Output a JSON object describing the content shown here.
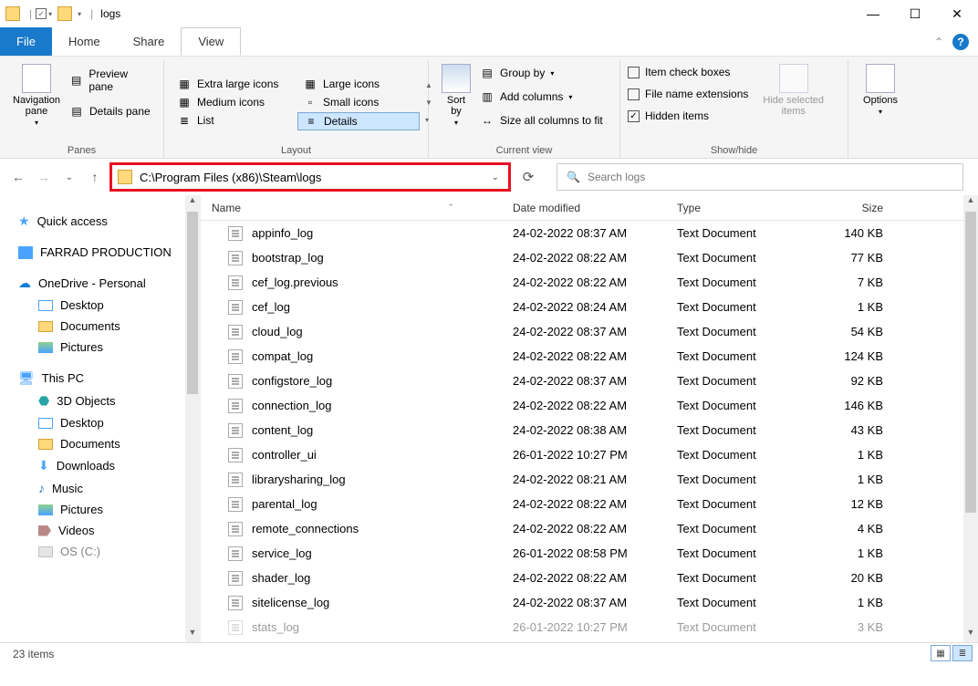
{
  "title": "logs",
  "menubar": {
    "file": "File",
    "home": "Home",
    "share": "Share",
    "view": "View"
  },
  "ribbon": {
    "panes": {
      "nav": "Navigation\npane",
      "preview": "Preview pane",
      "details": "Details pane",
      "label": "Panes"
    },
    "layout": {
      "items": [
        "Extra large icons",
        "Large icons",
        "Medium icons",
        "Small icons",
        "List",
        "Details"
      ],
      "label": "Layout"
    },
    "current": {
      "sort": "Sort\nby",
      "group": "Group by",
      "addcols": "Add columns",
      "sizeall": "Size all columns to fit",
      "label": "Current view"
    },
    "showhide": {
      "itemcheck": "Item check boxes",
      "fileext": "File name extensions",
      "hidden": "Hidden items",
      "hidesel": "Hide selected\nitems",
      "label": "Show/hide"
    },
    "options": "Options"
  },
  "address": "C:\\Program Files (x86)\\Steam\\logs",
  "search_placeholder": "Search logs",
  "columns": {
    "name": "Name",
    "date": "Date modified",
    "type": "Type",
    "size": "Size"
  },
  "sidebar": {
    "quick": "Quick access",
    "farrad": "FARRAD PRODUCTION",
    "onedrive": "OneDrive - Personal",
    "od_items": [
      "Desktop",
      "Documents",
      "Pictures"
    ],
    "thispc": "This PC",
    "pc_items": [
      "3D Objects",
      "Desktop",
      "Documents",
      "Downloads",
      "Music",
      "Pictures",
      "Videos",
      "OS (C:)"
    ]
  },
  "files": [
    {
      "name": "appinfo_log",
      "date": "24-02-2022 08:37 AM",
      "type": "Text Document",
      "size": "140 KB"
    },
    {
      "name": "bootstrap_log",
      "date": "24-02-2022 08:22 AM",
      "type": "Text Document",
      "size": "77 KB"
    },
    {
      "name": "cef_log.previous",
      "date": "24-02-2022 08:22 AM",
      "type": "Text Document",
      "size": "7 KB"
    },
    {
      "name": "cef_log",
      "date": "24-02-2022 08:24 AM",
      "type": "Text Document",
      "size": "1 KB"
    },
    {
      "name": "cloud_log",
      "date": "24-02-2022 08:37 AM",
      "type": "Text Document",
      "size": "54 KB"
    },
    {
      "name": "compat_log",
      "date": "24-02-2022 08:22 AM",
      "type": "Text Document",
      "size": "124 KB"
    },
    {
      "name": "configstore_log",
      "date": "24-02-2022 08:37 AM",
      "type": "Text Document",
      "size": "92 KB"
    },
    {
      "name": "connection_log",
      "date": "24-02-2022 08:22 AM",
      "type": "Text Document",
      "size": "146 KB"
    },
    {
      "name": "content_log",
      "date": "24-02-2022 08:38 AM",
      "type": "Text Document",
      "size": "43 KB"
    },
    {
      "name": "controller_ui",
      "date": "26-01-2022 10:27 PM",
      "type": "Text Document",
      "size": "1 KB"
    },
    {
      "name": "librarysharing_log",
      "date": "24-02-2022 08:21 AM",
      "type": "Text Document",
      "size": "1 KB"
    },
    {
      "name": "parental_log",
      "date": "24-02-2022 08:22 AM",
      "type": "Text Document",
      "size": "12 KB"
    },
    {
      "name": "remote_connections",
      "date": "24-02-2022 08:22 AM",
      "type": "Text Document",
      "size": "4 KB"
    },
    {
      "name": "service_log",
      "date": "26-01-2022 08:58 PM",
      "type": "Text Document",
      "size": "1 KB"
    },
    {
      "name": "shader_log",
      "date": "24-02-2022 08:22 AM",
      "type": "Text Document",
      "size": "20 KB"
    },
    {
      "name": "sitelicense_log",
      "date": "24-02-2022 08:37 AM",
      "type": "Text Document",
      "size": "1 KB"
    },
    {
      "name": "stats_log",
      "date": "26-01-2022 10:27 PM",
      "type": "Text Document",
      "size": "3 KB"
    }
  ],
  "status": "23 items"
}
